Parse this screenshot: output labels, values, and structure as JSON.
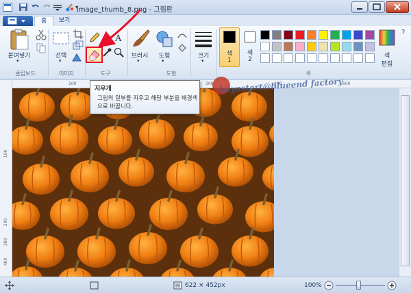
{
  "window": {
    "title": "image_thumb_8.png - 그림판"
  },
  "tabs": [
    {
      "label": "홈"
    },
    {
      "label": "보기"
    }
  ],
  "ribbon": {
    "clipboard": {
      "paste_label": "붙여넣기",
      "group_label": "클립보드"
    },
    "image": {
      "select_label": "선택",
      "group_label": "이미지"
    },
    "tools": {
      "group_label": "도구"
    },
    "brushes": {
      "label": "브러시"
    },
    "shapes": {
      "label": "도형",
      "group_label": "도형"
    },
    "size": {
      "label": "크기"
    },
    "colors": {
      "color1_label": "색",
      "color1_num": "1",
      "color2_label": "색",
      "color2_num": "2",
      "edit_label": "색",
      "edit_label2": "편집",
      "group_label": "색",
      "color1": "#000000",
      "color2": "#ffffff",
      "palette_row1": [
        "#000000",
        "#7f7f7f",
        "#880015",
        "#ed1c24",
        "#ff7f27",
        "#fff200",
        "#22b14c",
        "#00a2e8",
        "#3f48cc",
        "#a349a4"
      ],
      "palette_row2": [
        "#ffffff",
        "#c3c3c3",
        "#b97a57",
        "#ffaec9",
        "#ffc90e",
        "#efe4b0",
        "#b5e61d",
        "#99d9ea",
        "#7092be",
        "#c8bfe7"
      ],
      "palette_row3": [
        "#ffffff",
        "#ffffff",
        "#ffffff",
        "#ffffff",
        "#ffffff",
        "#ffffff",
        "#ffffff",
        "#ffffff",
        "#ffffff",
        "#ffffff"
      ]
    }
  },
  "tooltip": {
    "title": "지우개",
    "body": "그림의 일부를 지우고 해당 부분을 배경색으로 바꿉니다."
  },
  "ruler": {
    "top_ticks": [
      "100",
      "200",
      "300",
      "400",
      "500"
    ],
    "left_ticks": [
      "100",
      "200",
      "300",
      "400"
    ]
  },
  "status": {
    "dimensions": "622 × 452px",
    "zoom": "100%"
  },
  "watermark": {
    "text": "hayostart@blueend factory"
  },
  "colors": {
    "ribbon_bg": "#e3ebf6",
    "highlight_red": "#e8102a",
    "canvas_bg": "#c9d7eb"
  }
}
